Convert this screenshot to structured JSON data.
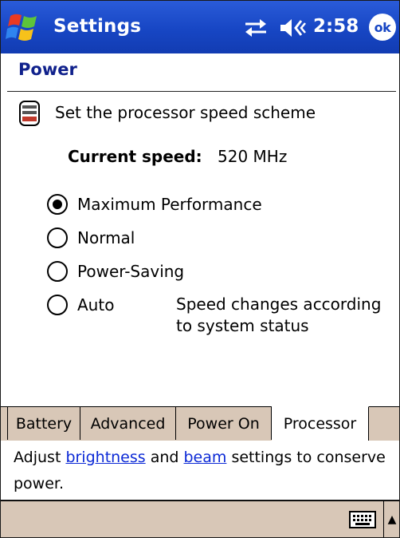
{
  "titlebar": {
    "app_title": "Settings",
    "time": "2:58",
    "ok_label": "ok",
    "icons": [
      "windows-start-icon",
      "connectivity-icon",
      "volume-icon"
    ]
  },
  "page": {
    "title": "Power",
    "scheme_label": "Set the processor speed scheme",
    "speed_label": "Current speed:",
    "speed_value": "520 MHz"
  },
  "options": [
    {
      "label": "Maximum Performance",
      "checked": true
    },
    {
      "label": "Normal",
      "checked": false
    },
    {
      "label": "Power-Saving",
      "checked": false
    },
    {
      "label": "Auto",
      "checked": false
    }
  ],
  "auto_note": "Speed changes according to system status",
  "tabs": [
    {
      "label": "Battery",
      "active": false
    },
    {
      "label": "Advanced",
      "active": false
    },
    {
      "label": "Power On",
      "active": false
    },
    {
      "label": "Processor",
      "active": true
    }
  ],
  "description": {
    "prefix": "Adjust ",
    "link1": "brightness",
    "middle": " and ",
    "link2": "beam",
    "suffix": " settings to conserve power."
  },
  "colors": {
    "titlebar": "#1746c4",
    "page_title": "#10218c",
    "tab_bg": "#d8c7b7",
    "link": "#0b29d6"
  }
}
